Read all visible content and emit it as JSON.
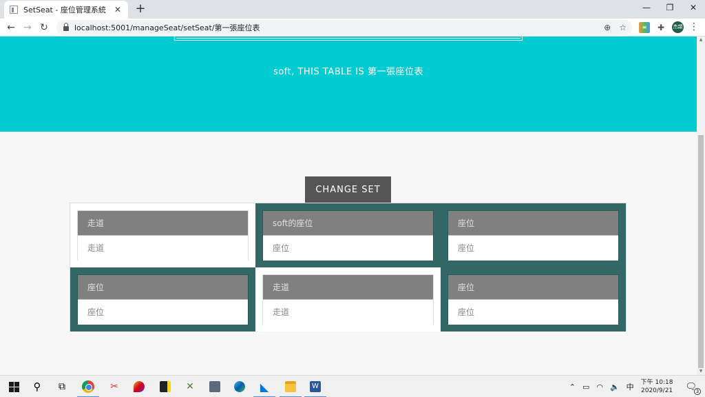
{
  "browser": {
    "tab_title": "SetSeat - 座位管理系統",
    "tab_close": "✕",
    "new_tab": "+",
    "url": "localhost:5001/manageSeat/setSeat/第一張座位表",
    "avatar_text": "杰頡",
    "window_controls": [
      "—",
      "❐",
      "✕"
    ]
  },
  "page": {
    "hero_text": "soft, THIS TABLE IS 第一張座位表",
    "change_button_label": "CHANGE SET",
    "rows": [
      [
        {
          "kind": "aisle",
          "header": "走道",
          "body": "走道",
          "active": false
        },
        {
          "kind": "seat",
          "header": "soft的座位",
          "body": "座位",
          "active": true
        },
        {
          "kind": "seat",
          "header": "座位",
          "body": "座位",
          "active": false
        }
      ],
      [
        {
          "kind": "seat",
          "header": "座位",
          "body": "座位",
          "active": false
        },
        {
          "kind": "aisle",
          "header": "走道",
          "body": "走道",
          "active": false
        },
        {
          "kind": "seat",
          "header": "座位",
          "body": "座位",
          "active": false
        }
      ]
    ]
  },
  "taskbar": {
    "ime": "中",
    "time": "下午 10:18",
    "date": "2020/9/21",
    "notification_count": "3",
    "apps": [
      "start-button",
      "search-icon",
      "task-view-icon",
      "chrome-icon",
      "snipping-tool-icon",
      "paint-3d-icon",
      "sticky-notes-icon",
      "tool-icon",
      "calculator-icon",
      "edge-icon",
      "vscode-icon",
      "file-explorer-icon",
      "word-icon"
    ]
  },
  "colors": {
    "hero": "#00cbd0",
    "seat": "#346866",
    "card_header": "#808080",
    "active_border": "#23c6c8",
    "button": "#555555"
  }
}
